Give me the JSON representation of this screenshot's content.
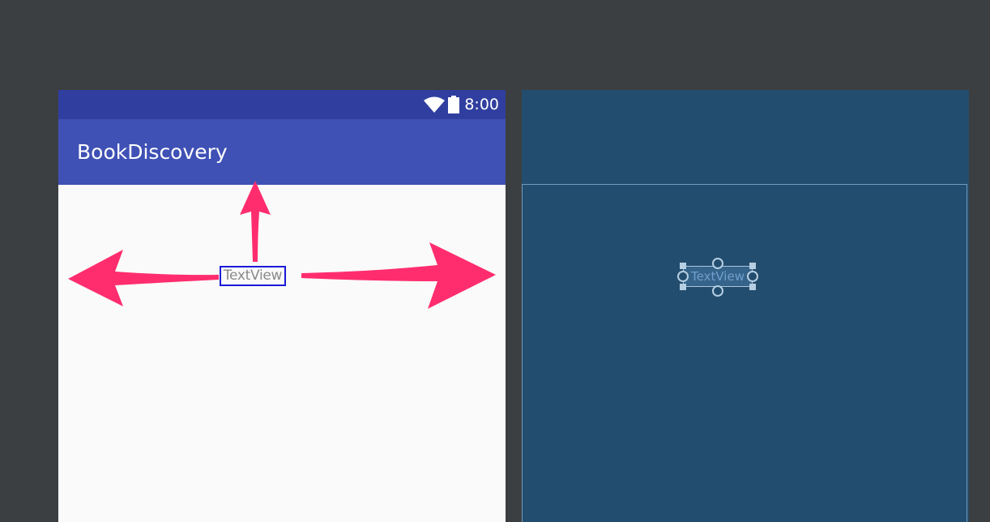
{
  "design_preview": {
    "status_bar": {
      "time": "8:00",
      "icons": [
        "wifi-icon",
        "battery-icon"
      ]
    },
    "app_bar": {
      "title": "BookDiscovery"
    },
    "textview": {
      "text": "TextView"
    },
    "arrows": [
      "arrow-left-icon",
      "arrow-up-icon",
      "arrow-right-icon"
    ]
  },
  "blueprint": {
    "textview": {
      "text": "TextView"
    }
  },
  "colors": {
    "editor_background": "#3c3f41",
    "status_bar": "#303f9f",
    "app_bar": "#3f51b5",
    "content_background": "#fafafa",
    "arrow": "#ff2d6e",
    "blueprint": "#234d6e"
  }
}
